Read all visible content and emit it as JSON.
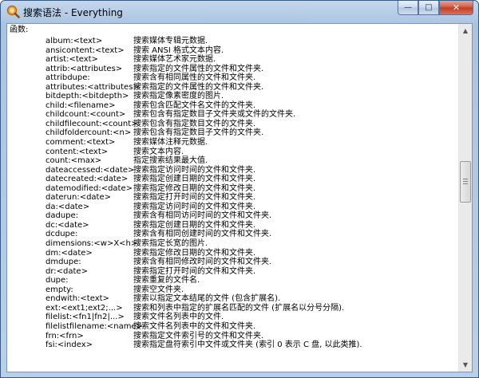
{
  "window": {
    "title": "搜索语法 - Everything",
    "minimize_glyph": "—",
    "maximize_glyph": "□",
    "close_glyph": "✕"
  },
  "content": {
    "heading": "函数:",
    "rows": [
      {
        "cmd": "album:<text>",
        "desc": "搜索媒体专辑元数据."
      },
      {
        "cmd": "ansicontent:<text>",
        "desc": "搜索 ANSI 格式文本内容."
      },
      {
        "cmd": "artist:<text>",
        "desc": "搜索媒体艺术家元数据."
      },
      {
        "cmd": "attrib:<attributes>",
        "desc": "搜索指定的文件属性的文件和文件夹."
      },
      {
        "cmd": "attribdupe:",
        "desc": "搜索含有相同属性的文件和文件夹."
      },
      {
        "cmd": "attributes:<attributes>",
        "desc": "搜索指定的文件属性的文件和文件夹."
      },
      {
        "cmd": "bitdepth:<bitdepth>",
        "desc": "搜索指定像素密度的图片."
      },
      {
        "cmd": "child:<filename>",
        "desc": "搜索包含匹配文件名文件的文件夹."
      },
      {
        "cmd": "childcount:<count>",
        "desc": "搜索包含有指定数目子文件夹或文件的文件夹."
      },
      {
        "cmd": "childfilecount:<count>",
        "desc": "搜索包含有指定数目文件的文件夹."
      },
      {
        "cmd": "childfoldercount:<n>",
        "desc": "搜索包含有指定数目子文件的文件夹."
      },
      {
        "cmd": "comment:<text>",
        "desc": "搜索媒体注释元数据."
      },
      {
        "cmd": "content:<text>",
        "desc": "搜索文本内容."
      },
      {
        "cmd": "count:<max>",
        "desc": "指定搜索结果最大值."
      },
      {
        "cmd": "dateaccessed:<date>",
        "desc": "搜索指定访问时间的文件和文件夹."
      },
      {
        "cmd": "datecreated:<date>",
        "desc": "搜索指定创建日期的文件和文件夹."
      },
      {
        "cmd": "datemodified:<date>",
        "desc": "搜索指定修改日期的文件和文件夹."
      },
      {
        "cmd": "daterun:<date>",
        "desc": "搜索指定打开时间的文件和文件夹."
      },
      {
        "cmd": "da:<date>",
        "desc": "搜索指定访问时间的文件和文件夹."
      },
      {
        "cmd": "dadupe:",
        "desc": "搜索含有相同访问时间的文件和文件夹."
      },
      {
        "cmd": "dc:<date>",
        "desc": "搜索指定创建日期的文件和文件夹."
      },
      {
        "cmd": "dcdupe:",
        "desc": "搜索含有相同创建时间的文件和文件夹."
      },
      {
        "cmd": "dimensions:<w>X<h>",
        "desc": "搜索指定长宽的图片."
      },
      {
        "cmd": "dm:<date>",
        "desc": "搜索指定修改日期的文件和文件夹."
      },
      {
        "cmd": "dmdupe:",
        "desc": "搜索含有相同修改时间的文件和文件夹."
      },
      {
        "cmd": "dr:<date>",
        "desc": "搜索指定打开时间的文件和文件夹."
      },
      {
        "cmd": "dupe:",
        "desc": "搜索重复的文件名."
      },
      {
        "cmd": "empty:",
        "desc": "搜索空文件夹."
      },
      {
        "cmd": "endwith:<text>",
        "desc": "搜索以指定文本结尾的文件 (包含扩展名)."
      },
      {
        "cmd": "ext:<ext1;ext2;...>",
        "desc": "搜索和列表中指定的扩展名匹配的文件 (扩展名以分号分隔)."
      },
      {
        "cmd": "filelist:<fn1|fn2|...>",
        "desc": "搜索文件名列表中的文件."
      },
      {
        "cmd": "filelistfilename:<name>",
        "desc": "搜索文件名列表中的文件和文件夹."
      },
      {
        "cmd": "frn:<frn>",
        "desc": "搜索指定文件索引号的文件和文件夹."
      },
      {
        "cmd": "fsi:<index>",
        "desc": "搜索指定盘符索引中文件或文件夹 (索引 0 表示 C 盘, 以此类推)."
      }
    ]
  },
  "scrollbar": {
    "up_glyph": "▲",
    "down_glyph": "▼"
  }
}
